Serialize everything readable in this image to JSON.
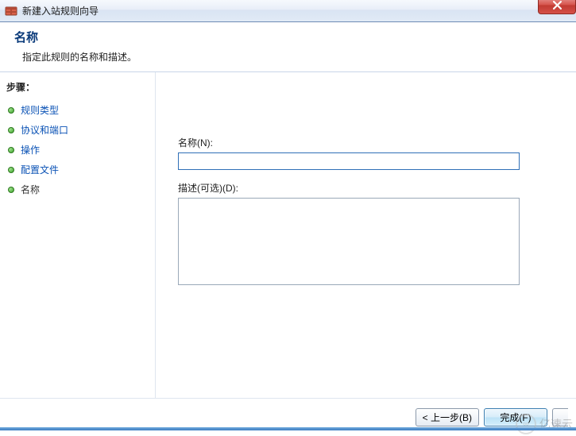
{
  "window": {
    "title": "新建入站规则向导"
  },
  "header": {
    "title": "名称",
    "subtitle": "指定此规则的名称和描述。"
  },
  "sidebar": {
    "steps_label": "步骤：",
    "items": [
      {
        "label": "规则类型",
        "current": false
      },
      {
        "label": "协议和端口",
        "current": false
      },
      {
        "label": "操作",
        "current": false
      },
      {
        "label": "配置文件",
        "current": false
      },
      {
        "label": "名称",
        "current": true
      }
    ]
  },
  "form": {
    "name_label": "名称(N):",
    "name_value": "",
    "desc_label": "描述(可选)(D):",
    "desc_value": ""
  },
  "footer": {
    "back_label": "< 上一步(B)",
    "finish_label": "完成(F)",
    "cancel_label": ""
  },
  "watermark": {
    "text": "亿速云"
  }
}
